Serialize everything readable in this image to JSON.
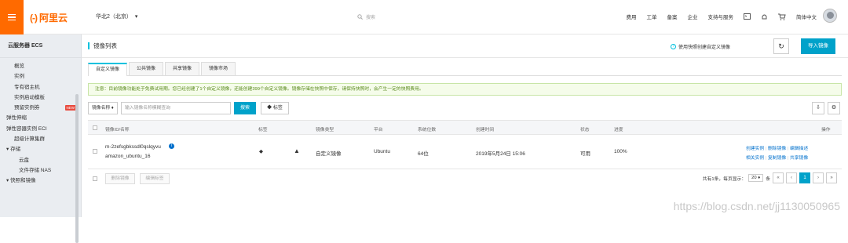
{
  "topbar": {
    "logo": "阿里云",
    "logo_mark": "(-)",
    "region": "华北2（北京）",
    "region_caret": "▾",
    "search_placeholder": "搜索",
    "nav": [
      "费用",
      "工单",
      "备案",
      "企业",
      "支持与服务"
    ],
    "lang": "简体中文"
  },
  "sidebar": {
    "title": "云服务器 ECS",
    "items": [
      {
        "label": "概览",
        "kind": "item"
      },
      {
        "label": "实例",
        "kind": "item"
      },
      {
        "label": "专有宿主机",
        "kind": "item"
      },
      {
        "label": "实例启动模板",
        "kind": "item"
      },
      {
        "label": "预留实例券",
        "kind": "item",
        "badge": "NEW"
      },
      {
        "label": "弹性伸缩",
        "kind": "group"
      },
      {
        "label": "弹性容器实例 ECI",
        "kind": "group"
      },
      {
        "label": "超级计算集群",
        "kind": "item"
      },
      {
        "label": "▾ 存储",
        "kind": "group"
      },
      {
        "label": "云盘",
        "kind": "sub"
      },
      {
        "label": "文件存储 NAS",
        "kind": "sub"
      },
      {
        "label": "▾ 快照和镜像",
        "kind": "group"
      }
    ]
  },
  "page": {
    "title": "镜像列表",
    "help_link": "使用快照创建自定义镜像",
    "refresh_icon": "↻",
    "import_btn": "导入镜像",
    "tabs": [
      "自定义镜像",
      "公共镜像",
      "共享镜像",
      "镜像市场"
    ],
    "notice": "注意：目前镜像功能处于免费试用期。您已经创建了1个自定义镜像，还能创建399个自定义镜像。镜像存储在快照中保存，请保持快照时，会产生一定的快照费用。",
    "filter_select": "镜像名称 ♦",
    "filter_placeholder": "输入镜像名称模糊查询",
    "filter_btn": "搜索",
    "tag_btn": "标签",
    "columns": [
      "镜像ID/名称",
      "标签",
      "镜像类型",
      "平台",
      "系统位数",
      "创建时间",
      "状态",
      "进度",
      "操作"
    ],
    "row": {
      "id": "m-2zefsgbkssdl0qslqyvu",
      "name": "amazon_ubuntu_16",
      "type": "自定义镜像",
      "platform": "Ubuntu",
      "bits": "64位",
      "created": "2019年5月24日 15:06",
      "status": "可用",
      "progress": "100%",
      "ops1": [
        "创建实例",
        "删除镜像",
        "编辑描述"
      ],
      "ops2": [
        "相关实例",
        "复制镜像",
        "共享镜像"
      ]
    },
    "footer_btns": [
      "删除镜像",
      "编辑标签"
    ],
    "pager_text": "共有1条，每页显示：",
    "pager_size": "20 ♦",
    "pager_unit": "条",
    "pages": [
      "«",
      "‹",
      "1",
      "›",
      "»"
    ]
  },
  "watermark": "https://blog.csdn.net/jj1130050965"
}
